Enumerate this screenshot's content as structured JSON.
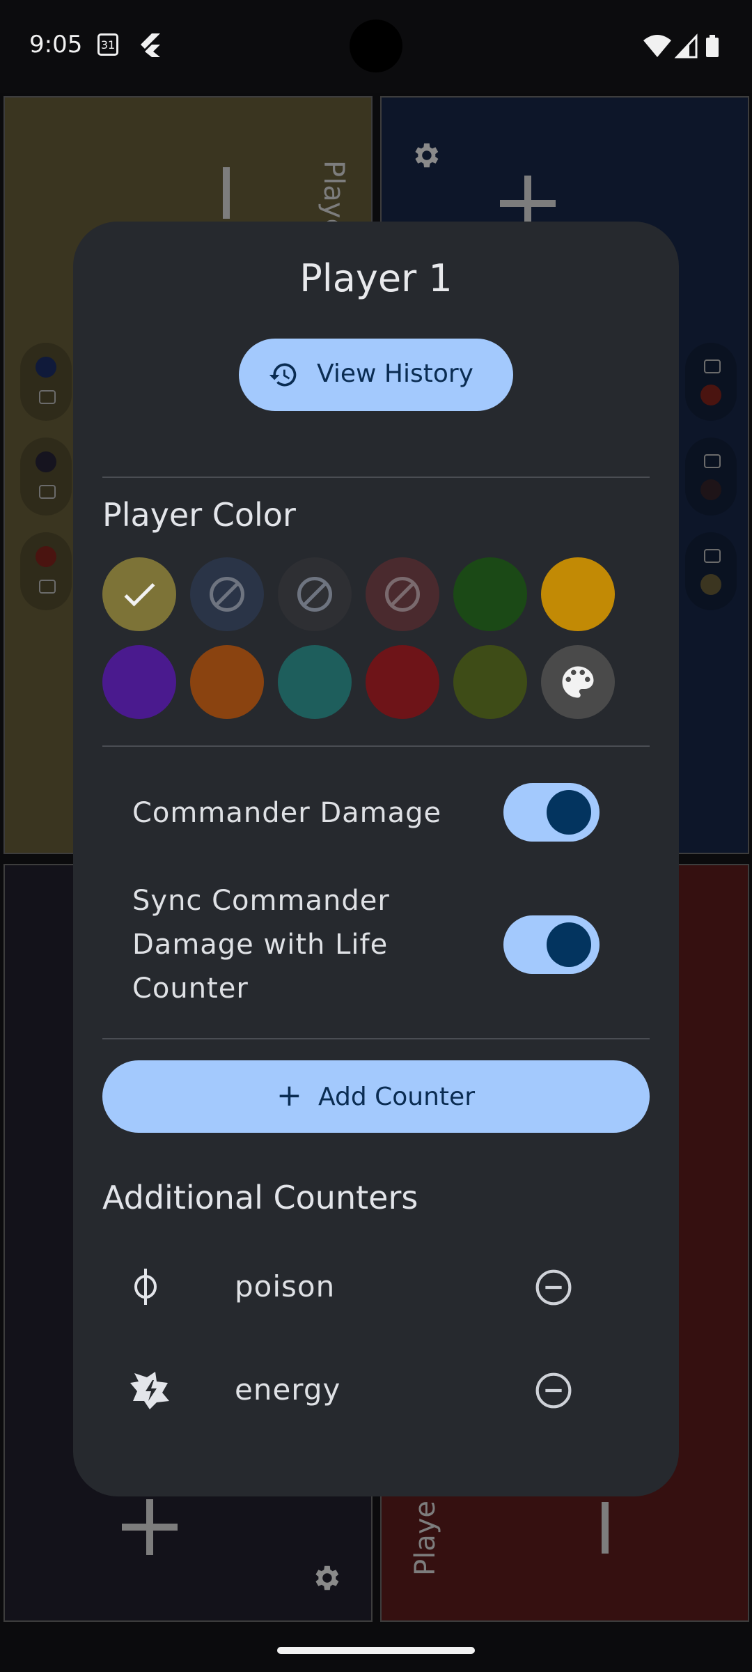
{
  "status_bar": {
    "time": "9:05",
    "calendar_day": "31"
  },
  "background_panels": {
    "top_left_label": "Playe",
    "bottom_right_label": "Playe"
  },
  "dialog": {
    "title": "Player 1",
    "view_history_label": "View History",
    "player_color_title": "Player Color",
    "colors_row1": [
      "#7d7337",
      "#2a3447",
      "#2e2f33",
      "#4a2a2e",
      "#1b4916",
      "#c28a05"
    ],
    "colors_row2": [
      "#4a1a8e",
      "#8a4310",
      "#1e5e5c",
      "#6e1418",
      "#3e4c17",
      "#4a4a4a"
    ],
    "colors_row1_state": [
      "selected",
      "disabled",
      "disabled",
      "disabled",
      "normal",
      "normal"
    ],
    "custom_color_icon": "palette-icon",
    "commander_damage_label": "Commander Damage",
    "commander_damage_on": true,
    "sync_label": "Sync Commander Damage with Life Counter",
    "sync_on": true,
    "add_counter_label": "Add Counter",
    "additional_counters_title": "Additional Counters",
    "counters": [
      {
        "name": "poison",
        "icon": "phi-icon"
      },
      {
        "name": "energy",
        "icon": "energy-icon"
      }
    ]
  }
}
